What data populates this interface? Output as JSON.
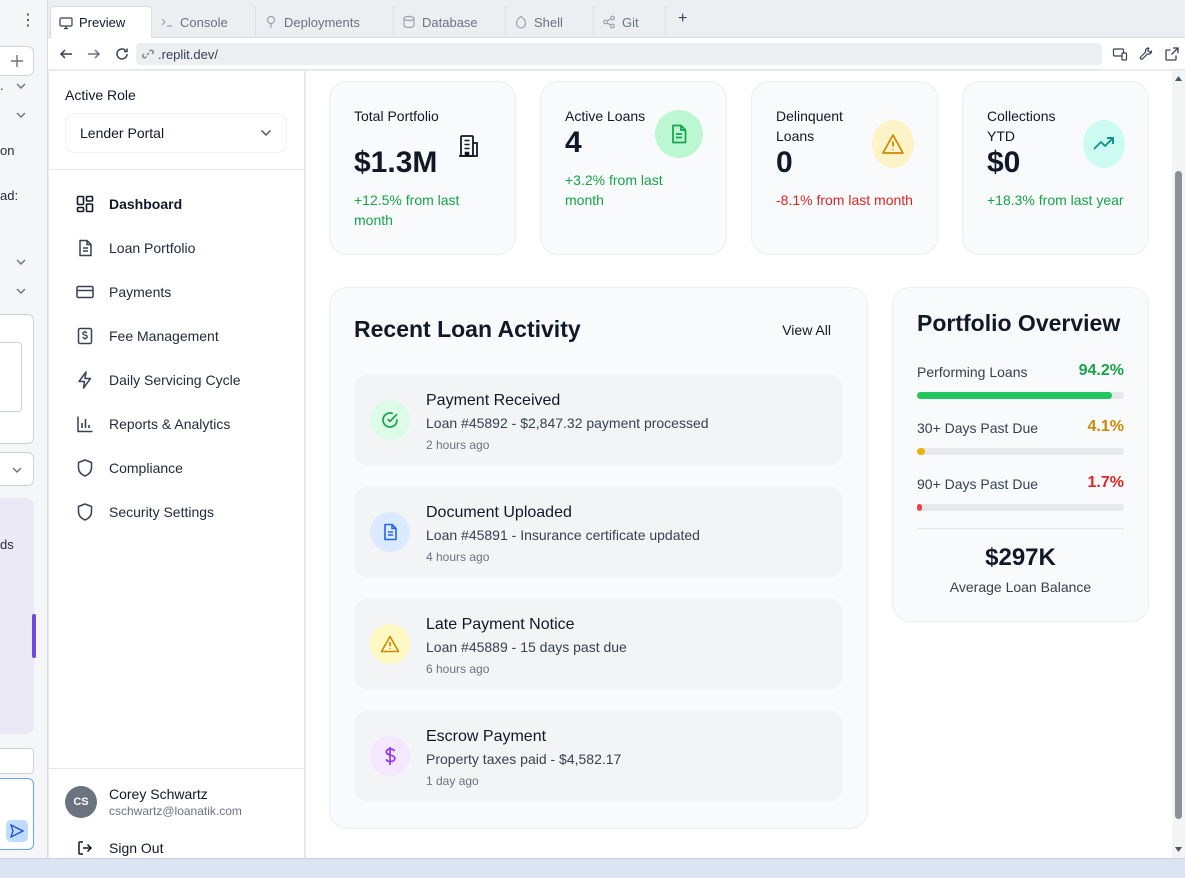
{
  "browser": {
    "tabs": [
      {
        "label": "Preview",
        "icon": "monitor-icon"
      },
      {
        "label": "Console",
        "icon": "terminal-icon"
      },
      {
        "label": "Deployments",
        "icon": "deploy-icon"
      },
      {
        "label": "Database",
        "icon": "database-icon"
      },
      {
        "label": "Shell",
        "icon": "shell-icon"
      },
      {
        "label": "Git",
        "icon": "git-icon"
      }
    ],
    "new_tab": "+",
    "url": ".replit.dev/"
  },
  "left_panel": {
    "fragments": [
      "on",
      "ad:",
      "ds"
    ]
  },
  "sidebar": {
    "role_label": "Active Role",
    "role_value": "Lender Portal",
    "nav": [
      {
        "label": "Dashboard",
        "icon": "dashboard-icon",
        "active": true
      },
      {
        "label": "Loan Portfolio",
        "icon": "document-icon"
      },
      {
        "label": "Payments",
        "icon": "credit-card-icon"
      },
      {
        "label": "Fee Management",
        "icon": "dollar-receipt-icon"
      },
      {
        "label": "Daily Servicing Cycle",
        "icon": "lightning-icon"
      },
      {
        "label": "Reports & Analytics",
        "icon": "bar-chart-icon"
      },
      {
        "label": "Compliance",
        "icon": "shield-icon"
      },
      {
        "label": "Security Settings",
        "icon": "shield-icon"
      }
    ],
    "user": {
      "initials": "CS",
      "name": "Corey Schwartz",
      "email": "cschwartz@loanatik.com"
    },
    "sign_out": "Sign Out"
  },
  "stats": [
    {
      "label": "Total Portfolio",
      "value": "$1.3M",
      "change": "+12.5% from last month",
      "trend": "up",
      "icon": "building-icon"
    },
    {
      "label": "Active Loans",
      "value": "4",
      "change": "+3.2% from last month",
      "trend": "up",
      "icon": "document-icon"
    },
    {
      "label": "Delinquent Loans",
      "value": "0",
      "change": "-8.1% from last month",
      "trend": "down",
      "icon": "warning-icon"
    },
    {
      "label": "Collections YTD",
      "value": "$0",
      "change": "+18.3% from last year",
      "trend": "up",
      "icon": "trending-up-icon"
    }
  ],
  "activity": {
    "title": "Recent Loan Activity",
    "view_all": "View All",
    "items": [
      {
        "title": "Payment Received",
        "desc": "Loan #45892 - $2,847.32 payment processed",
        "time": "2 hours ago",
        "icon": "check-circle-icon"
      },
      {
        "title": "Document Uploaded",
        "desc": "Loan #45891 - Insurance certificate updated",
        "time": "4 hours ago",
        "icon": "document-icon"
      },
      {
        "title": "Late Payment Notice",
        "desc": "Loan #45889 - 15 days past due",
        "time": "6 hours ago",
        "icon": "warning-icon"
      },
      {
        "title": "Escrow Payment",
        "desc": "Property taxes paid - $4,582.17",
        "time": "1 day ago",
        "icon": "dollar-icon"
      }
    ]
  },
  "overview": {
    "title": "Portfolio Overview",
    "rows": [
      {
        "label": "Performing Loans",
        "value": "94.2%",
        "fraction": 0.942,
        "color": "#22c55e"
      },
      {
        "label": "30+ Days Past Due",
        "value": "4.1%",
        "fraction": 0.041,
        "color": "#eab308"
      },
      {
        "label": "90+ Days Past Due",
        "value": "1.7%",
        "fraction": 0.017,
        "color": "#ef4444"
      }
    ],
    "avg_value": "$297K",
    "avg_label": "Average Loan Balance"
  },
  "colors": {
    "green": "#16a34a",
    "red": "#dc2626",
    "amber": "#ca8a04"
  }
}
